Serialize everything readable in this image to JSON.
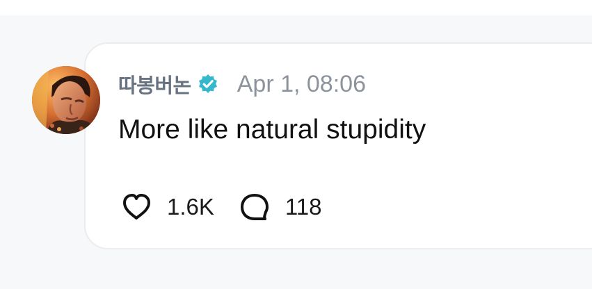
{
  "comment": {
    "author": {
      "name": "따봉버논",
      "verified": true,
      "avatar": "avatar-photo"
    },
    "timestamp": "Apr 1, 08:06",
    "text": "More like natural stupidity",
    "likes": {
      "count": "1.6K",
      "icon": "heart-icon"
    },
    "replies": {
      "count": "118",
      "icon": "comment-bubble-icon"
    }
  },
  "icons": {
    "verified": "verified-badge-icon"
  },
  "colors": {
    "background": "#f7f8fa",
    "card": "#ffffff",
    "card_border": "#ececef",
    "author": "#687280",
    "timestamp": "#8d939c",
    "text": "#111111",
    "verified": "#35b7cc"
  }
}
